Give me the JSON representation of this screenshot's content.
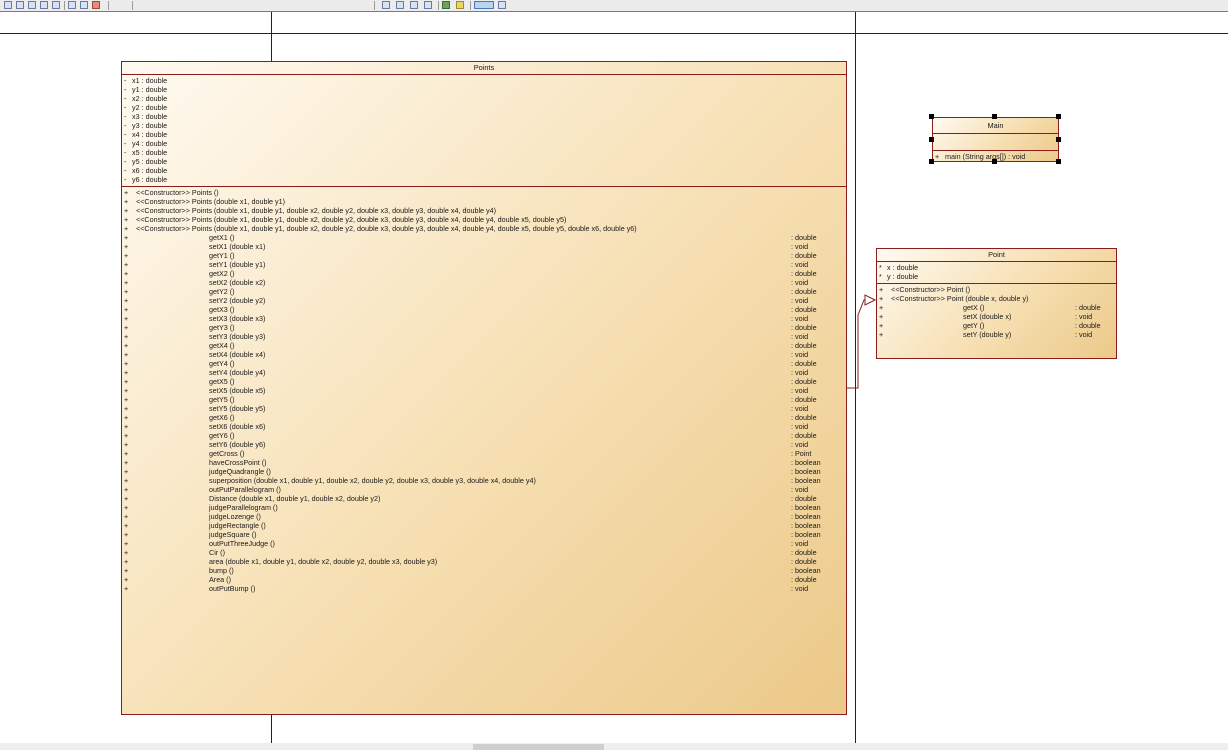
{
  "points": {
    "title": "Points",
    "attributes": [
      {
        "vis": "-",
        "text": "x1  : double"
      },
      {
        "vis": "-",
        "text": "y1  : double"
      },
      {
        "vis": "-",
        "text": "x2  : double"
      },
      {
        "vis": "-",
        "text": "y2  : double"
      },
      {
        "vis": "-",
        "text": "x3  : double"
      },
      {
        "vis": "-",
        "text": "y3  : double"
      },
      {
        "vis": "-",
        "text": "x4  : double"
      },
      {
        "vis": "-",
        "text": "y4  : double"
      },
      {
        "vis": "-",
        "text": "x5  : double"
      },
      {
        "vis": "-",
        "text": "y5  : double"
      },
      {
        "vis": "-",
        "text": "x6  : double"
      },
      {
        "vis": "-",
        "text": "y6  : double"
      }
    ],
    "constructors": [
      {
        "vis": "+",
        "text": "<<Constructor>>  Points ()"
      },
      {
        "vis": "+",
        "text": "<<Constructor>>  Points (double x1, double y1)"
      },
      {
        "vis": "+",
        "text": "<<Constructor>>  Points (double x1, double y1, double x2, double y2, double x3, double y3, double x4, double y4)"
      },
      {
        "vis": "+",
        "text": "<<Constructor>>  Points (double x1, double y1, double x2, double y2, double x3, double y3, double x4, double y4, double x5, double y5)"
      },
      {
        "vis": "+",
        "text": "<<Constructor>>  Points (double x1, double y1, double x2, double y2, double x3, double y3, double x4, double y4, double x5, double y5, double x6, double y6)"
      }
    ],
    "methods": [
      {
        "vis": "+",
        "name": "getX1 ()",
        "ret": ": double"
      },
      {
        "vis": "+",
        "name": "setX1 (double x1)",
        "ret": ": void"
      },
      {
        "vis": "+",
        "name": "getY1 ()",
        "ret": ": double"
      },
      {
        "vis": "+",
        "name": "setY1 (double y1)",
        "ret": ": void"
      },
      {
        "vis": "+",
        "name": "getX2 ()",
        "ret": ": double"
      },
      {
        "vis": "+",
        "name": "setX2 (double x2)",
        "ret": ": void"
      },
      {
        "vis": "+",
        "name": "getY2 ()",
        "ret": ": double"
      },
      {
        "vis": "+",
        "name": "setY2 (double y2)",
        "ret": ": void"
      },
      {
        "vis": "+",
        "name": "getX3 ()",
        "ret": ": double"
      },
      {
        "vis": "+",
        "name": "setX3 (double x3)",
        "ret": ": void"
      },
      {
        "vis": "+",
        "name": "getY3 ()",
        "ret": ": double"
      },
      {
        "vis": "+",
        "name": "setY3 (double y3)",
        "ret": ": void"
      },
      {
        "vis": "+",
        "name": "getX4 ()",
        "ret": ": double"
      },
      {
        "vis": "+",
        "name": "setX4 (double x4)",
        "ret": ": void"
      },
      {
        "vis": "+",
        "name": "getY4 ()",
        "ret": ": double"
      },
      {
        "vis": "+",
        "name": "setY4 (double y4)",
        "ret": ": void"
      },
      {
        "vis": "+",
        "name": "getX5 ()",
        "ret": ": double"
      },
      {
        "vis": "+",
        "name": "setX5 (double x5)",
        "ret": ": void"
      },
      {
        "vis": "+",
        "name": "getY5 ()",
        "ret": ": double"
      },
      {
        "vis": "+",
        "name": "setY5 (double y5)",
        "ret": ": void"
      },
      {
        "vis": "+",
        "name": "getX6 ()",
        "ret": ": double"
      },
      {
        "vis": "+",
        "name": "setX6 (double x6)",
        "ret": ": void"
      },
      {
        "vis": "+",
        "name": "getY6 ()",
        "ret": ": double"
      },
      {
        "vis": "+",
        "name": "setY6 (double y6)",
        "ret": ": void"
      },
      {
        "vis": "+",
        "name": "getCross ()",
        "ret": ": Point"
      },
      {
        "vis": "+",
        "name": "haveCrossPoint ()",
        "ret": ": boolean"
      },
      {
        "vis": "+",
        "name": "judgeQuadrangle ()",
        "ret": ": boolean"
      },
      {
        "vis": "+",
        "name": "superposition (double x1, double y1, double x2, double y2, double x3, double y3, double x4, double y4)",
        "ret": ": boolean"
      },
      {
        "vis": "+",
        "name": "outPutParallelogram ()",
        "ret": ": void"
      },
      {
        "vis": "+",
        "name": "Distance (double x1, double y1, double x2, double y2)",
        "ret": ": double"
      },
      {
        "vis": "+",
        "name": "judgeParallelogram ()",
        "ret": ": boolean"
      },
      {
        "vis": "+",
        "name": "judgeLozenge ()",
        "ret": ": boolean"
      },
      {
        "vis": "+",
        "name": "judgeRectangle ()",
        "ret": ": boolean"
      },
      {
        "vis": "+",
        "name": "judgeSquare ()",
        "ret": ": boolean"
      },
      {
        "vis": "+",
        "name": "outPutThreeJudge ()",
        "ret": ": void"
      },
      {
        "vis": "+",
        "name": "Cir ()",
        "ret": ": double"
      },
      {
        "vis": "+",
        "name": "area (double x1, double y1, double x2, double y2, double x3, double y3)",
        "ret": ": double"
      },
      {
        "vis": "+",
        "name": "bump ()",
        "ret": ": boolean"
      },
      {
        "vis": "+",
        "name": "Area ()",
        "ret": ": double"
      },
      {
        "vis": "+",
        "name": "outPutBump ()",
        "ret": ": void"
      }
    ]
  },
  "main": {
    "title": "Main",
    "methods": [
      {
        "vis": "+",
        "text": "main (String args[])  : void"
      }
    ]
  },
  "point": {
    "title": "Point",
    "attributes": [
      {
        "vis": "*",
        "text": "x  : double"
      },
      {
        "vis": "*",
        "text": "y  : double"
      }
    ],
    "constructors": [
      {
        "vis": "+",
        "text": "<<Constructor>>  Point ()"
      },
      {
        "vis": "+",
        "text": "<<Constructor>>  Point (double x, double y)"
      }
    ],
    "methods": [
      {
        "vis": "+",
        "name": "getX ()",
        "ret": ": double"
      },
      {
        "vis": "+",
        "name": "setX (double x)",
        "ret": ": void"
      },
      {
        "vis": "+",
        "name": "getY ()",
        "ret": ": double"
      },
      {
        "vis": "+",
        "name": "setY (double y)",
        "ret": ": void"
      }
    ]
  },
  "colors": {
    "class_border": "#8b1c1c",
    "class_fill_light": "#fffaf1",
    "class_fill_dark": "#ecc989",
    "connector": "#8b1c1c"
  }
}
